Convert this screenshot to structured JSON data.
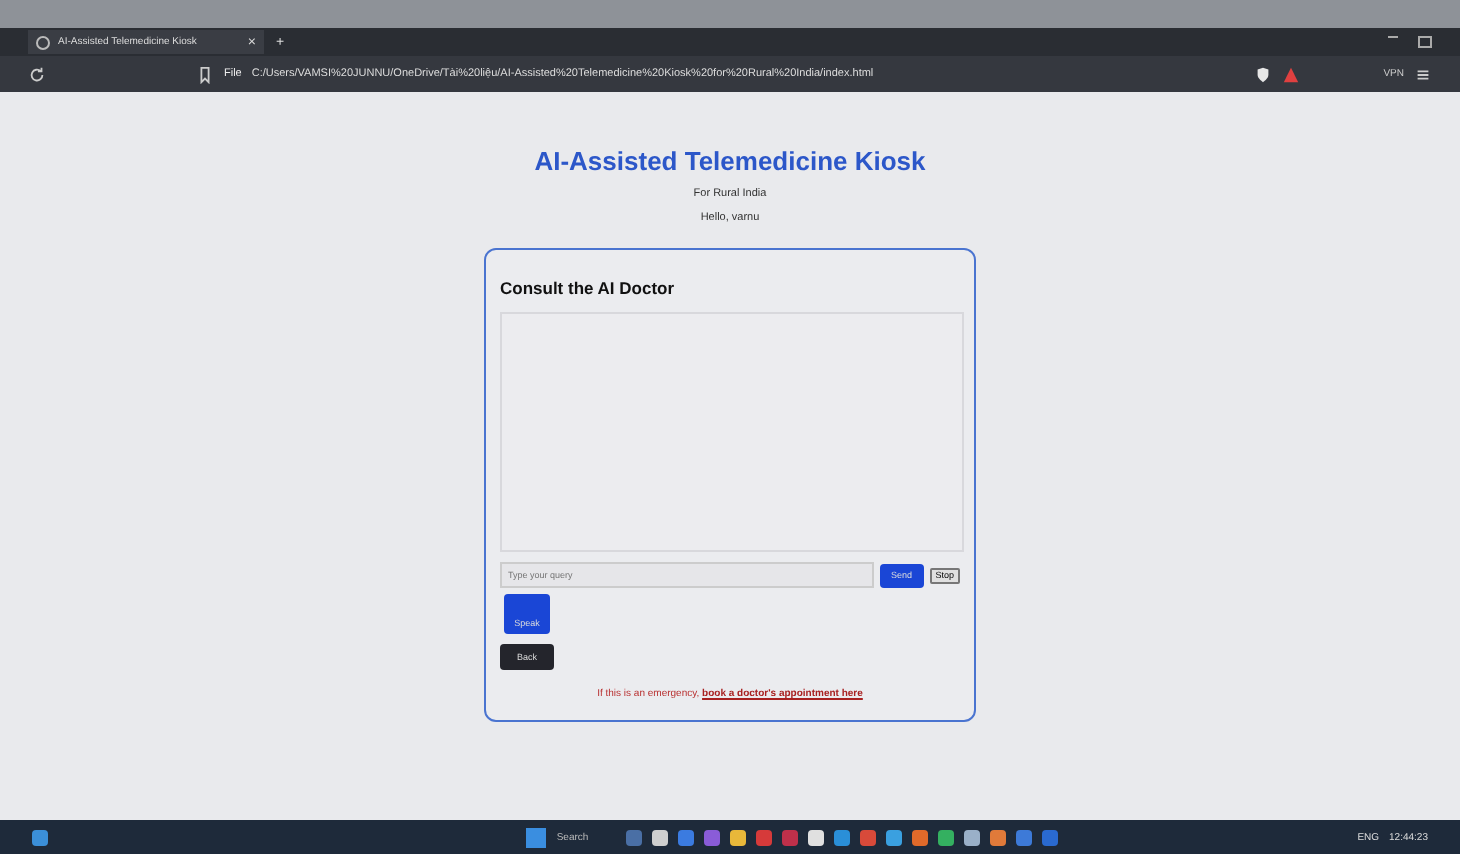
{
  "browser": {
    "tab_title": "AI-Assisted Telemedicine Kiosk",
    "tab_close": "×",
    "new_tab": "+",
    "address_scheme": "File",
    "address": "C:/Users/VAMSI%20JUNNU/OneDrive/Tài%20liệu/AI-Assisted%20Telemedicine%20Kiosk%20for%20Rural%20India/index.html",
    "vpn": "VPN"
  },
  "page": {
    "title": "AI-Assisted Telemedicine Kiosk",
    "subtitle": "For Rural India",
    "greeting": "Hello, varnu"
  },
  "card": {
    "heading": "Consult the AI Doctor",
    "query_placeholder": "Type your query",
    "send": "Send",
    "stop": "Stop",
    "speak": "Speak",
    "back": "Back",
    "emergency_text": "If this is an emergency,",
    "emergency_link": "book a doctor's appointment here"
  },
  "taskbar": {
    "search": "Search",
    "language": "ENG",
    "time": "12:44:23"
  }
}
